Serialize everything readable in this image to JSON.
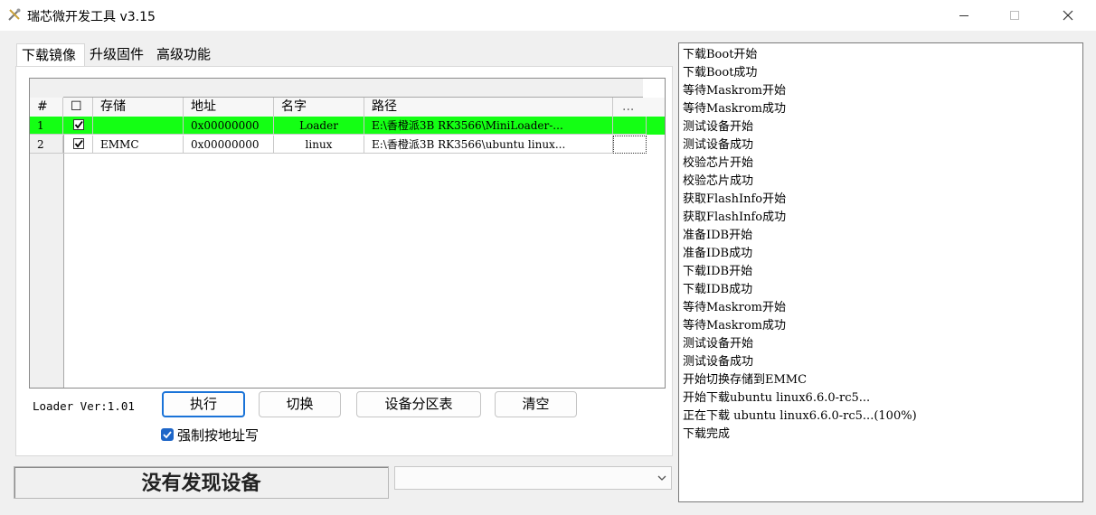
{
  "window": {
    "title": "瑞芯微开发工具 v3.15",
    "minimize_icon": "minimize-icon",
    "maximize_icon": "maximize-icon",
    "close_icon": "close-icon"
  },
  "tabs": [
    {
      "label": "下载镜像",
      "active": true
    },
    {
      "label": "升级固件",
      "active": false
    },
    {
      "label": "高级功能",
      "active": false
    }
  ],
  "table": {
    "headers": {
      "index": "#",
      "check": "☐",
      "storage": "存储",
      "address": "地址",
      "name": "名字",
      "path": "路径",
      "more": "..."
    },
    "rows": [
      {
        "index": "1",
        "checked": true,
        "storage": "",
        "address": "0x00000000",
        "name": "Loader",
        "path": "E:\\香橙派3B RK3566\\MiniLoader-...",
        "selected": true
      },
      {
        "index": "2",
        "checked": true,
        "storage": "EMMC",
        "address": "0x00000000",
        "name": "linux",
        "path": "E:\\香橙派3B RK3566\\ubuntu linux...",
        "selected": false
      }
    ]
  },
  "loader_version": "Loader Ver:1.01",
  "buttons": {
    "execute": "执行",
    "switch": "切换",
    "partition_table": "设备分区表",
    "clear": "清空"
  },
  "force_address_write": {
    "label": "强制按地址写",
    "checked": true
  },
  "status": "没有发现设备",
  "device_select": {
    "value": ""
  },
  "log_lines": [
    "下载Boot开始",
    "下载Boot成功",
    "等待Maskrom开始",
    "等待Maskrom成功",
    "测试设备开始",
    "测试设备成功",
    "校验芯片开始",
    "校验芯片成功",
    "获取FlashInfo开始",
    "获取FlashInfo成功",
    "准备IDB开始",
    "准备IDB成功",
    "下载IDB开始",
    "下载IDB成功",
    "等待Maskrom开始",
    "等待Maskrom成功",
    "测试设备开始",
    "测试设备成功",
    "开始切换存储到EMMC",
    "开始下载ubuntu linux6.6.0-rc5...",
    "正在下载 ubuntu linux6.6.0-rc5...(100%)",
    "下载完成"
  ],
  "colors": {
    "selected_row": "#14ff14",
    "primary_border": "#1a73d8",
    "check_blue": "#1e66c8"
  }
}
